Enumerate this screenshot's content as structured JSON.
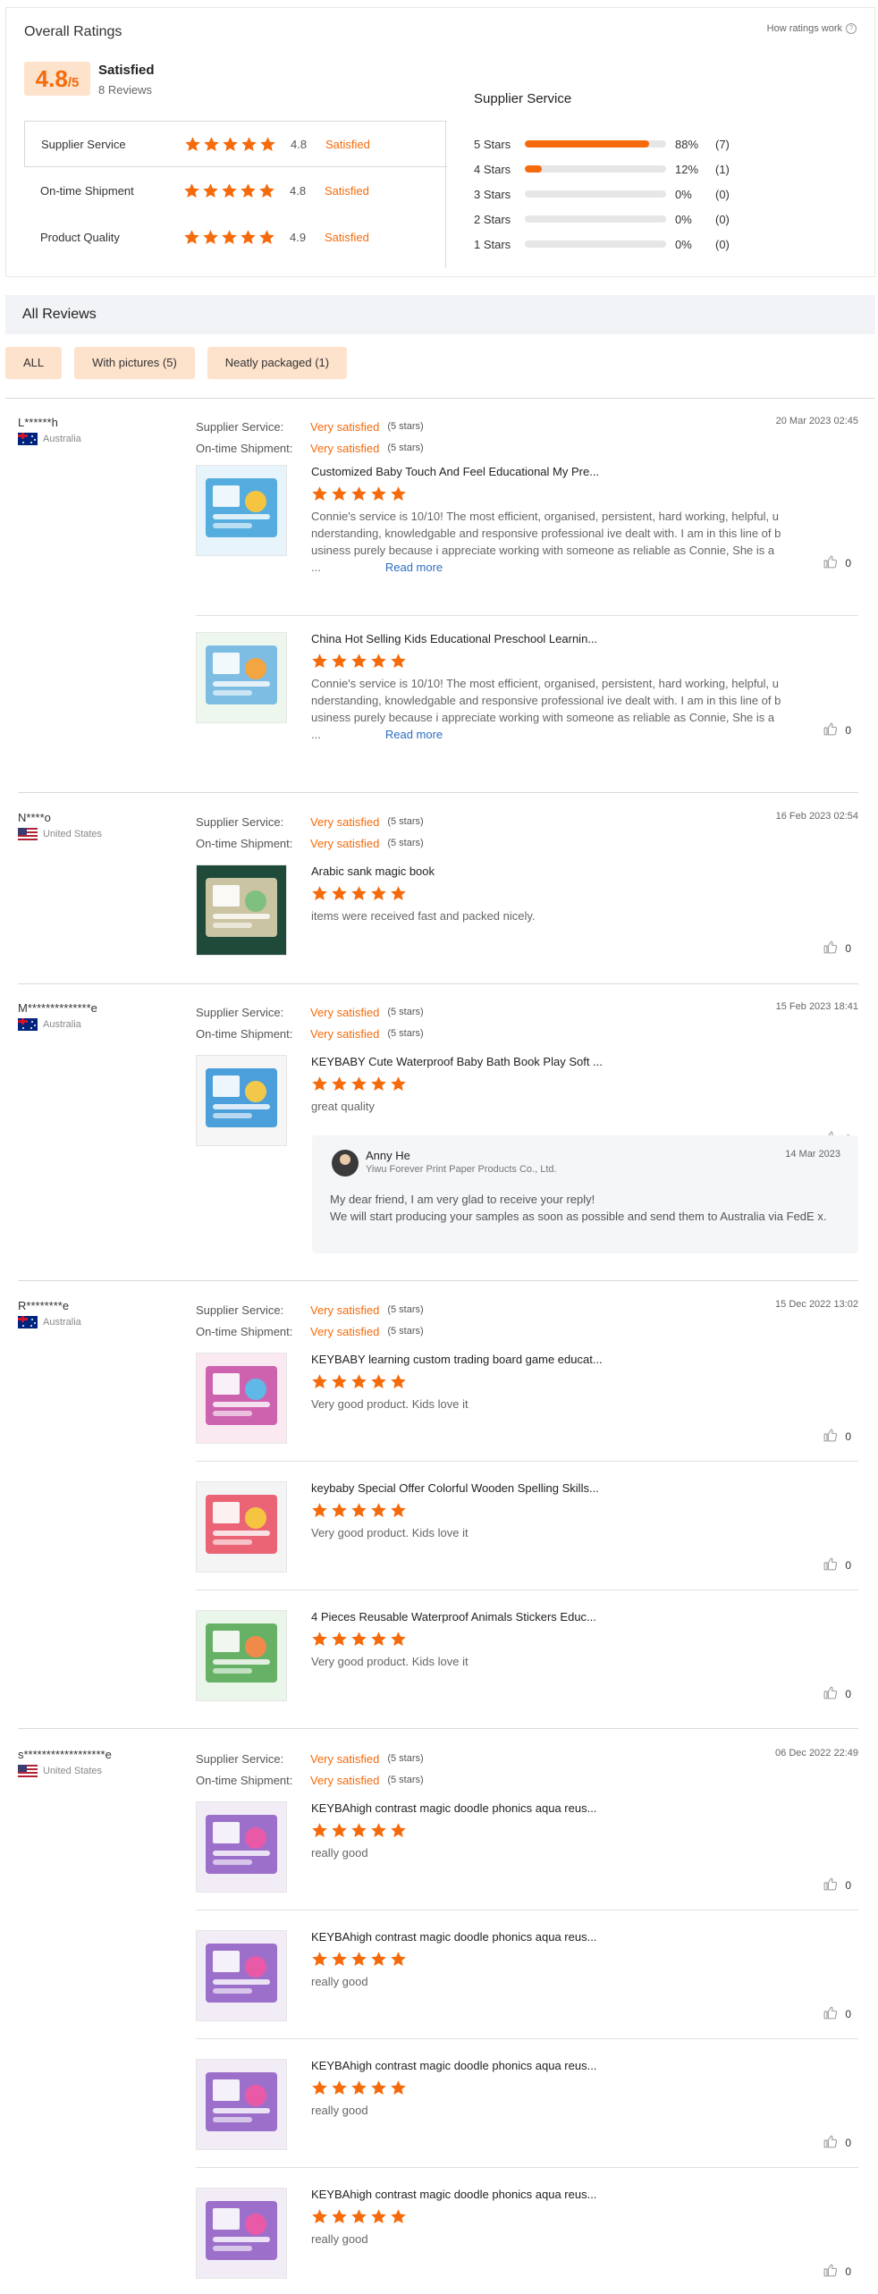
{
  "ratings": {
    "title": "Overall Ratings",
    "how_link": "How ratings work",
    "score": "4.8",
    "score_suffix": "/5",
    "score_label": "Satisfied",
    "review_count": "8 Reviews",
    "categories": [
      {
        "name": "Supplier Service",
        "value": "4.8",
        "label": "Satisfied"
      },
      {
        "name": "On-time Shipment",
        "value": "4.8",
        "label": "Satisfied"
      },
      {
        "name": "Product Quality",
        "value": "4.9",
        "label": "Satisfied"
      }
    ],
    "dist_title": "Supplier Service",
    "distribution": [
      {
        "label": "5 Stars",
        "percent": 88,
        "pct_text": "88%",
        "count": "(7)"
      },
      {
        "label": "4 Stars",
        "percent": 12,
        "pct_text": "12%",
        "count": "(1)"
      },
      {
        "label": "3 Stars",
        "percent": 0,
        "pct_text": "0%",
        "count": "(0)"
      },
      {
        "label": "2 Stars",
        "percent": 0,
        "pct_text": "0%",
        "count": "(0)"
      },
      {
        "label": "1 Stars",
        "percent": 0,
        "pct_text": "0%",
        "count": "(0)"
      }
    ],
    "star_color": "#f56b0c"
  },
  "all_reviews": {
    "title": "All Reviews",
    "filters": [
      "ALL",
      "With pictures (5)",
      "Neatly packaged (1)"
    ]
  },
  "labels": {
    "supplier_service": "Supplier Service:",
    "ontime": "On-time Shipment:",
    "very_satisfied": "Very satisfied",
    "five_stars": "(5 stars)",
    "read_more": "Read more"
  },
  "reviews": [
    {
      "name": "L******h",
      "country": "Australia",
      "date": "20 Mar 2023 02:45",
      "items": [
        {
          "title": "Customized Baby Touch And Feel Educational My Pre...",
          "text": "Connie's service is 10/10! The most efficient, organised, persistent, hard working, helpful, u nderstanding, knowledgable and responsive professional ive dealt with. I am in this line of b usiness purely because i appreciate working with someone as reliable as Connie, She is a ...",
          "likes": "0"
        },
        {
          "title": "China Hot Selling Kids Educational Preschool Learnin...",
          "text": "Connie's service is 10/10! The most efficient, organised, persistent, hard working, helpful, u nderstanding, knowledgable and responsive professional ive dealt with. I am in this line of b usiness purely because i appreciate working with someone as reliable as Connie, She is a ...",
          "likes": "0"
        }
      ]
    },
    {
      "name": "N****o",
      "country": "United States",
      "date": "16 Feb 2023 02:54",
      "items": [
        {
          "title": "Arabic sank magic book",
          "text": "items were received fast and packed nicely.",
          "likes": "0"
        }
      ]
    },
    {
      "name": "M**************e",
      "country": "Australia",
      "date": "15 Feb 2023 18:41",
      "items": [
        {
          "title": "KEYBABY Cute Waterproof Baby Bath Book Play Soft ...",
          "text": "great quality",
          "likes": "0"
        }
      ],
      "reply": {
        "name": "Anny He",
        "company": "Yiwu Forever Print Paper Products Co., Ltd.",
        "date": "14 Mar 2023",
        "text": "My dear friend, I am very glad to receive your reply!\nWe will start producing your samples as soon as possible and send them to Australia via FedE x."
      }
    },
    {
      "name": "R********e",
      "country": "Australia",
      "date": "15 Dec 2022 13:02",
      "items": [
        {
          "title": "KEYBABY learning custom trading board game educat...",
          "text": "Very good product. Kids love it",
          "likes": "0"
        },
        {
          "title": "keybaby Special Offer Colorful Wooden Spelling Skills...",
          "text": "Very good product. Kids love it",
          "likes": "0"
        },
        {
          "title": "4 Pieces Reusable Waterproof Animals Stickers Educ...",
          "text": "Very good product. Kids love it",
          "likes": "0"
        }
      ]
    },
    {
      "name": "s******************e",
      "country": "United States",
      "date": "06 Dec 2022 22:49",
      "items": [
        {
          "title": "KEYBAhigh contrast magic doodle phonics aqua reus...",
          "text": "really good",
          "likes": "0"
        },
        {
          "title": "KEYBAhigh contrast magic doodle phonics aqua reus...",
          "text": "really good",
          "likes": "0"
        },
        {
          "title": "KEYBAhigh contrast magic doodle phonics aqua reus...",
          "text": "really good",
          "likes": "0"
        },
        {
          "title": "KEYBAhigh contrast magic doodle phonics aqua reus...",
          "text": "really good",
          "likes": "0"
        }
      ]
    }
  ]
}
